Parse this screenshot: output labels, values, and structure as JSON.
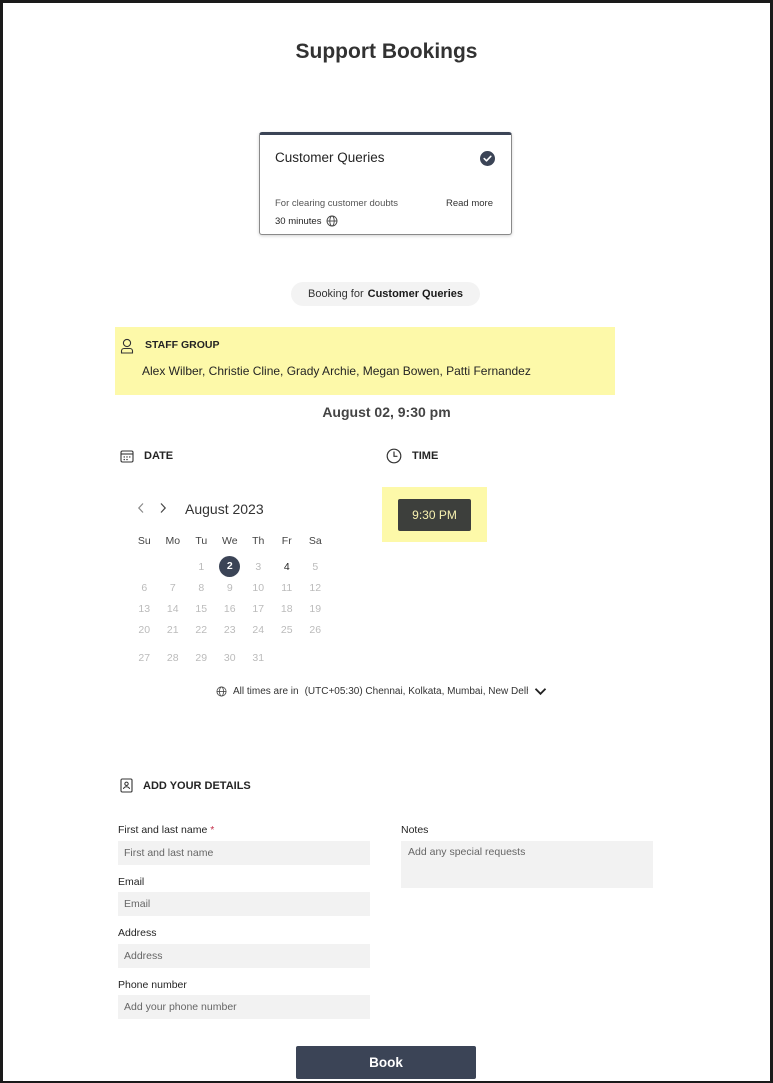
{
  "page": {
    "title": "Support Bookings"
  },
  "service": {
    "name": "Customer Queries",
    "description": "For clearing customer doubts",
    "read_more": "Read more",
    "duration": "30 minutes"
  },
  "booking_for": {
    "prefix": "Booking for",
    "service": "Customer Queries"
  },
  "staff": {
    "heading": "STAFF GROUP",
    "names": "Alex Wilber, Christie Cline, Grady Archie, Megan Bowen, Patti Fernandez"
  },
  "selected_datetime": "August 02, 9:30 pm",
  "date_section": {
    "heading": "DATE"
  },
  "time_section": {
    "heading": "TIME",
    "slot": "9:30 PM"
  },
  "calendar": {
    "month_label": "August 2023",
    "weekdays": [
      "Su",
      "Mo",
      "Tu",
      "We",
      "Th",
      "Fr",
      "Sa"
    ],
    "weeks": [
      [
        "",
        "",
        "1",
        "2",
        "3",
        "4",
        "5"
      ],
      [
        "6",
        "7",
        "8",
        "9",
        "10",
        "11",
        "12"
      ],
      [
        "13",
        "14",
        "15",
        "16",
        "17",
        "18",
        "19"
      ],
      [
        "20",
        "21",
        "22",
        "23",
        "24",
        "25",
        "26"
      ],
      [
        "27",
        "28",
        "29",
        "30",
        "31",
        "",
        ""
      ]
    ],
    "selected_day": "2",
    "available_days": [
      "4"
    ]
  },
  "timezone": {
    "prefix": "All times are in",
    "value": "(UTC+05:30) Chennai, Kolkata, Mumbai, New Delhi"
  },
  "details": {
    "heading": "ADD YOUR DETAILS",
    "name_label": "First and last name",
    "name_required": "*",
    "name_placeholder": "First and last name",
    "email_label": "Email",
    "email_placeholder": "Email",
    "address_label": "Address",
    "address_placeholder": "Address",
    "phone_label": "Phone number",
    "phone_placeholder": "Add your phone number",
    "notes_label": "Notes",
    "notes_placeholder": "Add any special requests"
  },
  "book_button": "Book",
  "colors": {
    "accent": "#3b4456",
    "highlight": "#fdf9a9",
    "time_slot": "#3d3f3c"
  }
}
